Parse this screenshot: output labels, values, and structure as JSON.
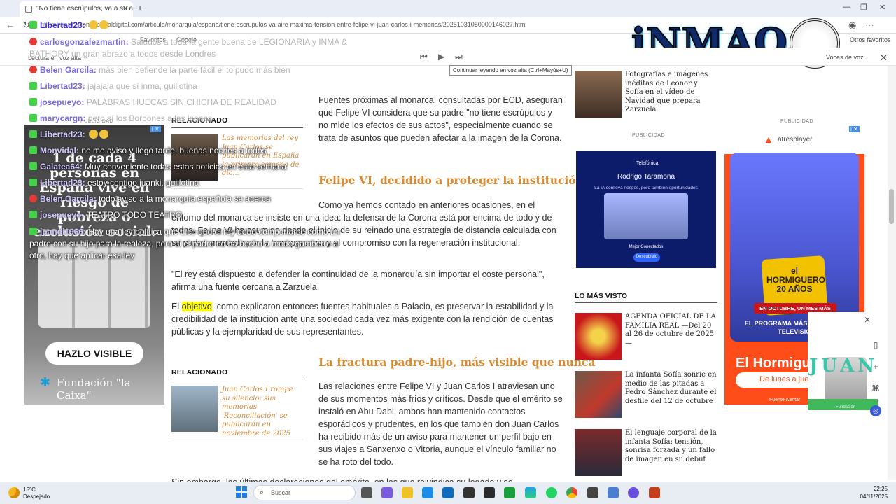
{
  "browser": {
    "tab_title": "\"No tiene escrúpulos, va a su aire...",
    "url": "https://www.elconfidencialdigital.com/articulo/monarquia/espana/tiene-escrupulos-va-aire-maxima-tension-entre-felipe-vi-juan-carlos-i-memorias/20251031050000146027.html",
    "bookmarks": [
      "Favoritos",
      "Google",
      "Otros favoritos"
    ]
  },
  "read_aloud": {
    "label": "Lectura en voz alta",
    "tooltip": "Continuar leyendo en voz alta (Ctrl+Mayús+U)",
    "voice_label": "Voces de voz"
  },
  "logo": {
    "text": "iNMAQ",
    "amp": "&"
  },
  "chat": [
    {
      "user": "Libertad23",
      "msg": "",
      "icon": "kick",
      "style": "normal"
    },
    {
      "user": "carlosgonzalezmartin",
      "msg": "Saludos a toda la gente buena de LEGIONARIA y INMA & BATHORY un gran abrazo a todos desde Londres",
      "icon": "yt",
      "style": "faded"
    },
    {
      "user": "Belen Garcila",
      "msg": "más bien defiende la parte fácil el tolpudo más bien",
      "icon": "yt",
      "style": "faded"
    },
    {
      "user": "Libertad23",
      "msg": "jajajaja que sí inma, guillotina",
      "icon": "kick",
      "style": "faded"
    },
    {
      "user": "josepueyo",
      "msg": "PALABRAS HUECAS SIN CHICHA DE REALIDAD",
      "icon": "kick",
      "style": "faded"
    },
    {
      "user": "marycargn",
      "msg": "pero sí los Borbones a las leonas",
      "icon": "kick",
      "style": "faded"
    },
    {
      "user": "Libertad23",
      "msg": "",
      "icon": "kick",
      "style": "dark"
    },
    {
      "user": "Monvidal",
      "msg": "no me aviso y llego tarde, buenas noches a todos",
      "icon": "kick",
      "style": "dark"
    },
    {
      "user": "Galatea64",
      "msg": "Muy conveniente todas estas noticias en esta semana",
      "icon": "kick",
      "style": "dark"
    },
    {
      "user": "Libertad23",
      "msg": "estoy contigo juanki, guillotina",
      "icon": "kick",
      "style": "dark"
    },
    {
      "user": "Belen Garcila",
      "msg": "todo aviso a la monarquía española se acerca",
      "icon": "yt",
      "style": "dark"
    },
    {
      "user": "josepueyo",
      "msg": "TEATRO TODO TEATRO",
      "icon": "kick",
      "style": "dark"
    },
    {
      "user": "juandi1966",
      "msg": "Hay una ley política que dice que el rey debe comportarse como un padre con su hijo para la realeza, pero si el padre no ha hecho a modo gamberro a otro, hay que aplicar esa ley",
      "icon": "kick",
      "style": "dark"
    }
  ],
  "left_ad": {
    "badge": "PUBLICIDAD",
    "headline": "1 de cada 4 personas en España vive en riesgo de pobreza o exclusión social.",
    "cta": "HAZLO VISIBLE",
    "brand": "Fundación \"la Caixa\""
  },
  "article": {
    "p1": "Fuentes próximas al monarca, consultadas por ECD, aseguran que Felipe VI considera que su padre \"no tiene escrúpulos y no mide los efectos de sus actos\", especialmente cuando se trata de asuntos que pueden afectar a la imagen de la Corona.",
    "h1": "Felipe VI, decidido a proteger la institución",
    "p2a": "Como ya hemos contado en anteriores ocasiones, en el",
    "p2b": "entorno del monarca se insiste en una idea: la defensa de la Corona está por encima de todo y de todos. Felipe VI ha asumido desde el inicio de su reinado una estrategia de distancia calculada con su padre, marcada por la transparencia y el compromiso con la regeneración institucional.",
    "p3": "\"El rey está dispuesto a defender la continuidad de la monarquía sin importar el coste personal\", afirma una fuente cercana a Zarzuela.",
    "p4_pre": "El",
    "p4_hl": "objetivo",
    "p4_post": ", como explicaron entonces fuentes habituales a Palacio, es preservar la estabilidad y la credibilidad de la institución ante una sociedad cada vez más exigente con la rendición de cuentas públicas y la ejemplaridad de sus representantes.",
    "h2": "La fractura padre-hijo, más visible que nunca",
    "p5": "Las relaciones entre Felipe VI y Juan Carlos I atraviesan uno de sus momentos más fríos y críticos. Desde que el emérito se instaló en Abu Dabi, ambos han mantenido contactos esporádicos y prudentes, en los que también don Juan Carlos ha recibido más de un aviso para mantener un perfil bajo en sus viajes a Sanxenxo o Vitoria, aunque el vínculo familiar no se ha roto del todo.",
    "p6": "Sin embargo, las últimas declaraciones del emérito, en las que reivindica su legado y se"
  },
  "related": [
    {
      "heading": "RELACIONADO",
      "text": "Las memorias del rey Juan Carlos se publicarán en España la primera semana de dic..."
    },
    {
      "heading": "RELACIONADO",
      "text": "Juan Carlos I rompe su silencio: sus memorias 'Reconciliación' se publicarán en noviembre de 2025"
    }
  ],
  "sidebar": {
    "top_item": "Fotografías e imágenes inéditas de Leonor y Sofía en el vídeo de Navidad que prepara Zarzuela",
    "pub_label": "PUBLICIDAD",
    "tele_ad": {
      "brand": "Telefónica",
      "name": "Rodrigo Taramona",
      "sub": "La IA conlleva riesgos, pero también oportunidades",
      "labels": "Mejor      Conectados",
      "button": "Descúbrelo"
    },
    "most_read_title": "LO MÁS VISTO",
    "most_read": [
      "AGENDA OFICIAL DE LA FAMILIA REAL —Del 20 al 26 de octubre de 2025—",
      "La infanta Sofía sonríe en medio de las pitadas a Pedro Sánchez durante el desfile del 12 de octubre",
      "El lenguaje corporal de la infanta Sofía: tensión, sonrisa forzada y un fallo de imagen en su debut"
    ]
  },
  "big_ad": {
    "brand": "atresplayer",
    "badge_text": "el HORMIGUERO 20 AÑOS",
    "octo": "EN OCTUBRE, UN MES MÁS",
    "prog": "EL PROGRAMA MÁS VISTO DE LA TELEVISIÓN",
    "title": "El Hormiguero",
    "days": "De lunes a jueves",
    "src": "Fuente Kantar"
  },
  "small_promo": {
    "word": "JUAN",
    "fund": "Fundación"
  },
  "taskbar": {
    "temp": "15°C",
    "weather": "Despejado",
    "search_placeholder": "Buscar",
    "time": "22:25",
    "date": "04/11/2025"
  },
  "colors": {
    "accent_orange": "#d9892e",
    "chat_user": "#3d2bd1",
    "kick_green": "#45d14a"
  }
}
